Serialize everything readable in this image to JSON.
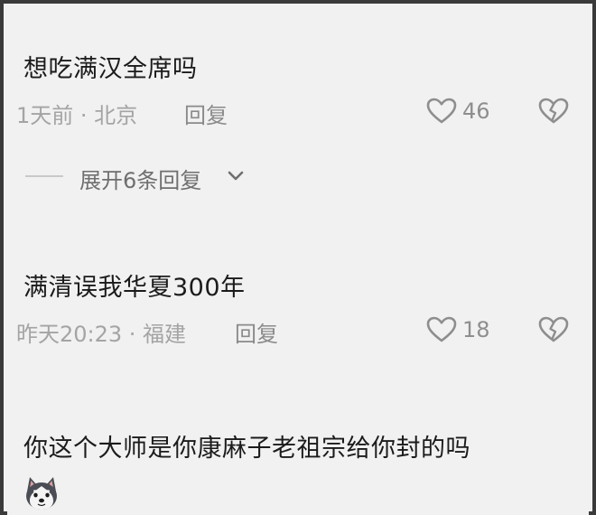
{
  "comments": [
    {
      "text": "想吃满汉全席吗",
      "time_location": "1天前 · 北京",
      "reply_label": "回复",
      "like_count": "46",
      "expand_replies_label": "展开6条回复"
    },
    {
      "text": "满清误我华夏300年",
      "time_location": "昨天20:23 · 福建",
      "reply_label": "回复",
      "like_count": "18"
    },
    {
      "text": "你这个大师是你康麻子老祖宗给你封的吗"
    }
  ],
  "icons": {
    "like": "heart-outline-icon",
    "dislike": "broken-heart-icon",
    "expand": "chevron-down-icon",
    "avatar": "husky-dog-avatar"
  },
  "colors": {
    "background": "#f1f1f1",
    "text_primary": "#1b1b1b",
    "text_meta": "#a4a4a4",
    "icon": "#8e8e8e",
    "border": "#3a3a3a"
  }
}
